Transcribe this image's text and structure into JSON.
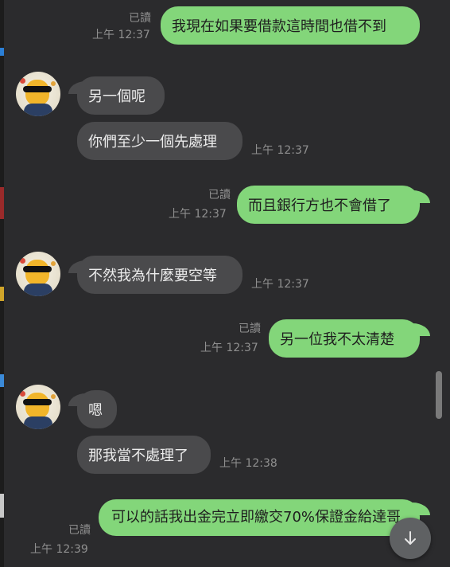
{
  "messages": [
    {
      "dir": "out",
      "text": "我現在如果要借款這時間也借不到",
      "read": "已讀",
      "time": "上午 12:37"
    },
    {
      "dir": "in",
      "text": "另一個呢"
    },
    {
      "dir": "in",
      "text": "你們至少一個先處理",
      "time": "上午 12:37"
    },
    {
      "dir": "out",
      "text": "而且銀行方也不會借了",
      "read": "已讀",
      "time": "上午 12:37"
    },
    {
      "dir": "in",
      "text": "不然我為什麼要空等",
      "time": "上午 12:37"
    },
    {
      "dir": "out",
      "text": "另一位我不太清楚",
      "read": "已讀",
      "time": "上午 12:37"
    },
    {
      "dir": "in",
      "text": "嗯"
    },
    {
      "dir": "in",
      "text": "那我當不處理了",
      "time": "上午 12:38"
    },
    {
      "dir": "out",
      "text": "可以的話我出金完立即繳交70%保證金給達哥",
      "read": "已讀",
      "time": "上午 12:39"
    }
  ],
  "icons": {
    "scroll_down": "arrow-down-icon",
    "avatar": "contact-avatar"
  },
  "colors": {
    "background": "#2b2b2d",
    "incoming_bubble": "#4a4a4c",
    "outgoing_bubble": "#83d67a",
    "meta_text": "#8f8f8f"
  }
}
